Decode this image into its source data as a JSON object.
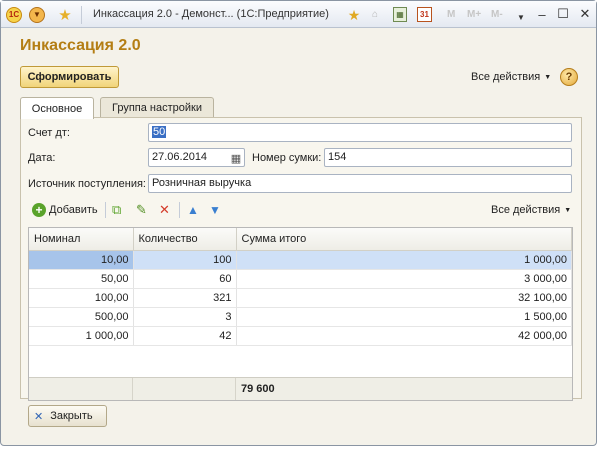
{
  "window": {
    "title": "Инкассация 2.0 - Демонст...  (1С:Предприятие)",
    "logo": "1С",
    "m_buttons": [
      "M",
      "M+",
      "M-"
    ]
  },
  "form": {
    "title": "Инкассация 2.0",
    "generate_label": "Сформировать",
    "all_actions_label": "Все действия",
    "help_label": "?"
  },
  "tabs": [
    {
      "label": "Основное",
      "active": true
    },
    {
      "label": "Группа настройки",
      "active": false
    }
  ],
  "fields": {
    "account_label": "Счет дт:",
    "account_value": "50",
    "date_label": "Дата:",
    "date_value": "27.06.2014",
    "sum_number_label": "Номер сумки:",
    "sum_number_value": "154",
    "source_label": "Источник поступления:",
    "source_value": "Розничная выручка"
  },
  "table_toolbar": {
    "add_label": "Добавить",
    "all_actions_label": "Все действия"
  },
  "table": {
    "columns": [
      "Номинал",
      "Количество",
      "Сумма итого"
    ],
    "rows": [
      {
        "nominal": "10,00",
        "qty": "100",
        "total": "1 000,00"
      },
      {
        "nominal": "50,00",
        "qty": "60",
        "total": "3 000,00"
      },
      {
        "nominal": "100,00",
        "qty": "321",
        "total": "32 100,00"
      },
      {
        "nominal": "500,00",
        "qty": "3",
        "total": "1 500,00"
      },
      {
        "nominal": "1 000,00",
        "qty": "42",
        "total": "42 000,00"
      }
    ],
    "footer_total": "79 600"
  },
  "close_label": "Закрыть",
  "colors": {
    "title": "#b47e14",
    "selection": "#3a6fc4",
    "add_icon": "#5aa32b",
    "delete_icon": "#d43b2a",
    "move_icon": "#3a7fd0"
  }
}
